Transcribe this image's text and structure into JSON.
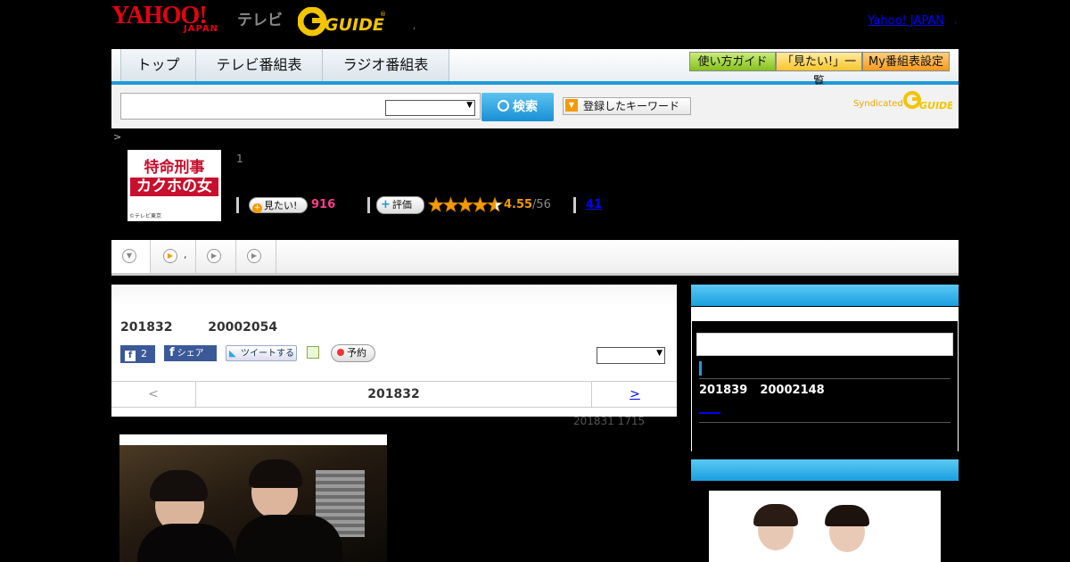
{
  "header": {
    "yahoo_logo": "YAHOO!",
    "yahoo_logo_sub": "JAPAN",
    "tv_label": "テレビ",
    "gguide_logo": "GUIDE",
    "yahoo_japan_link": "Yahoo! JAPAN",
    "separator": ","
  },
  "nav": {
    "tabs": [
      {
        "label": "トップ"
      },
      {
        "label": "テレビ番組表"
      },
      {
        "label": "ラジオ番組表"
      }
    ],
    "buttons": [
      {
        "label": "使い方ガイド",
        "color": "#9bd12f"
      },
      {
        "label": "「見たい!」一覧",
        "color": "#ffd34d"
      },
      {
        "label": "My番組表設定",
        "color": "#ffa533"
      }
    ]
  },
  "search": {
    "input_value": "",
    "select_value": "",
    "button_label": "検索",
    "keyword_button_label": "登録したキーワード",
    "syndicated_label": "Syndicated",
    "syndicated_logo": "GUIDE"
  },
  "breadcrumb": ">",
  "program": {
    "thumb_title_line1": "特命刑事",
    "thumb_title_line2": "カクホの女",
    "thumb_credit": "©テレビ東京",
    "episode_number": "1",
    "want_button_label": "見たい!",
    "want_count": "916",
    "rate_button_label": "評価",
    "stars": 4.55,
    "rating": "4.55",
    "rating_count": "/56",
    "review_count": "41"
  },
  "subtabs": [
    {
      "label": ""
    },
    {
      "label": ","
    },
    {
      "label": ""
    },
    {
      "label": ""
    }
  ],
  "main": {
    "episode_date": "201832",
    "episode_time": "20002054",
    "fb_like_count": "2",
    "fb_share_label": "シェア",
    "tweet_label": "ツイートする",
    "reserve_label": "予約",
    "select_value": "",
    "date_nav": {
      "prev": "<",
      "current": "201832",
      "next": ">"
    },
    "updated": "201831  1715"
  },
  "sidebar": {
    "next_date": "201839",
    "next_time": "20002148",
    "next_link": "____"
  },
  "colors": {
    "accent_blue": "#1f9ad8",
    "want_pink": "#ff3c8c",
    "rating_orange": "#f39b00",
    "link_blue": "#0000ff"
  }
}
